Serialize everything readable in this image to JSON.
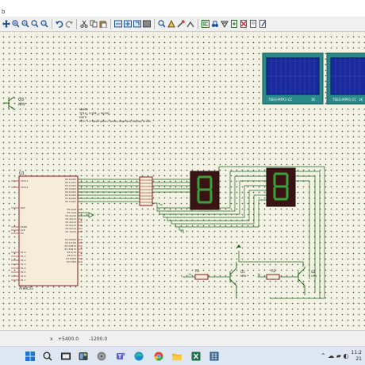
{
  "menu": {
    "fragment": "b"
  },
  "toolbar": {
    "icons": [
      "move-icon",
      "zoom-in-icon",
      "zoom-out-icon",
      "zoom-fit-icon",
      "zoom-area-icon",
      "undo-icon",
      "redo-icon",
      "cut-icon",
      "copy-icon",
      "paste-icon",
      "block-copy-icon",
      "block-move-icon",
      "block-rotate-icon",
      "block-delete-icon",
      "pick-device-icon",
      "make-device-icon",
      "packaging-icon",
      "decompose-icon",
      "wire-autorouter-icon",
      "search-tag-icon",
      "property-assign-icon",
      "new-sheet-icon",
      "remove-sheet-icon",
      "goto-sheet-icon",
      "bill-of-materials-icon"
    ]
  },
  "schematic": {
    "u1_label": "U1",
    "u1_part": "AT89C51",
    "u1_left_pins": [
      "XTAL1",
      "XTAL2",
      "RST",
      "PSEN",
      "ALE",
      "EA",
      "P1.0",
      "P1.1",
      "P1.2",
      "P1.3",
      "P1.4",
      "P1.5",
      "P1.6",
      "P1.7"
    ],
    "u1_right_pins": [
      "P0.0/AD0",
      "P0.1/AD1",
      "P0.2/AD2",
      "P0.3/AD3",
      "P0.4/AD4",
      "P0.5/AD5",
      "P0.6/AD6",
      "P0.7/AD7",
      "P2.0/A8",
      "P2.1/A9",
      "P2.2/A10",
      "P2.3/A11",
      "P2.4/A12",
      "P2.5/A13",
      "P2.6/A14",
      "P2.7/A15",
      "P3.0/RXD",
      "P3.1/TXD",
      "P3.2/INT0",
      "P3.3/INT1",
      "P3.4/T0",
      "P3.5/T1",
      "P3.6/WR",
      "P3.7/RD"
    ],
    "text_block": [
      "NAME: ",
      "TITLE: CODE = MUSIC",
      "DATE: ",
      "REV: 1.0  Description: Seven-segment display driver"
    ],
    "q3_label": "Q3",
    "q3_part": "NPN",
    "q1_label": "Q1",
    "q1_part": "NPN",
    "q2_label": "Q2",
    "q2_part": "NPN",
    "r1_label": "R1",
    "r1_value": "1k",
    "r2_label": "R2",
    "r2_value": "1k",
    "lcd1_caption": "7SEG-MPX1-CC",
    "lcd2_caption": "7SEG-MPX1-CC",
    "lcd1_value": "1K",
    "lcd2_value": "1K"
  },
  "status": {
    "x_label": "x",
    "x_value": "+5400.0",
    "y_value": "-1200.0"
  },
  "taskbar": {
    "icons": [
      "windows-start-icon",
      "search-icon",
      "task-view-icon",
      "widgets-icon",
      "chrome-icon",
      "teams-icon",
      "edge-icon",
      "chrome-profile-icon",
      "file-explorer-icon",
      "excel-icon",
      "proteus-icon"
    ],
    "time": "11:2",
    "date": "21"
  },
  "colors": {
    "wire": "#1f6a1f",
    "component": "#8b1a1a",
    "display_bg": "#3a1414",
    "segment_on": "#3aa23a",
    "lcd_bezel": "#2a8a8a",
    "lcd_screen": "#1a2a9a",
    "canvas": "#f3f3e4"
  }
}
